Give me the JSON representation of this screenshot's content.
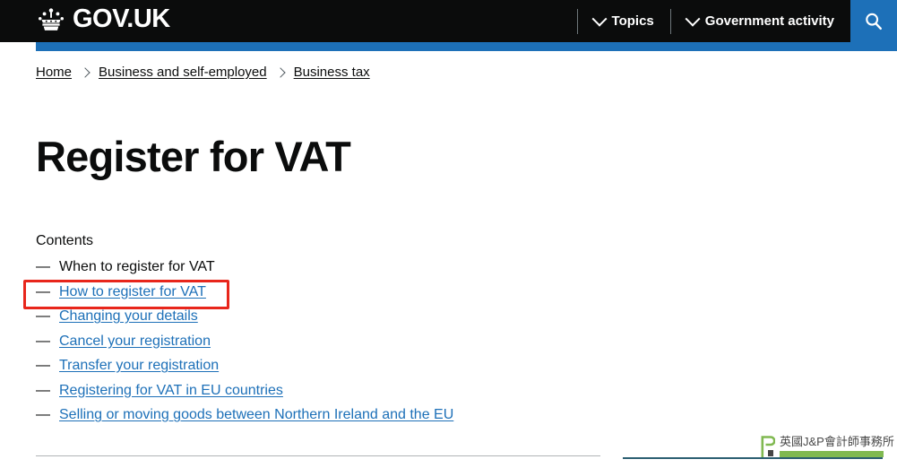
{
  "header": {
    "brand_name": "GOV.UK",
    "crown_icon": "crown-icon",
    "nav": [
      {
        "label": "Topics",
        "icon": "chevron-down-icon"
      },
      {
        "label": "Government activity",
        "icon": "chevron-down-icon"
      }
    ],
    "search_icon": "search-icon",
    "accent_color": "#1d70b8",
    "background_color": "#0b0c0c"
  },
  "breadcrumbs": [
    {
      "label": "Home"
    },
    {
      "label": "Business and self-employed"
    },
    {
      "label": "Business tax"
    }
  ],
  "main": {
    "title": "Register for VAT",
    "contents_label": "Contents",
    "contents": [
      {
        "label": "When to register for VAT",
        "current": true
      },
      {
        "label": "How to register for VAT",
        "current": false
      },
      {
        "label": "Changing your details",
        "current": false
      },
      {
        "label": "Cancel your registration",
        "current": false
      },
      {
        "label": "Transfer your registration",
        "current": false
      },
      {
        "label": "Registering for VAT in EU countries",
        "current": false
      },
      {
        "label": "Selling or moving goods between Northern Ireland and the EU",
        "current": false
      }
    ]
  },
  "annotation": {
    "target_label": "How to register for VAT",
    "box_color": "#e8261b"
  },
  "watermark": {
    "text": "英國J&P會計師事務所",
    "mark_color": "#7ab648"
  }
}
